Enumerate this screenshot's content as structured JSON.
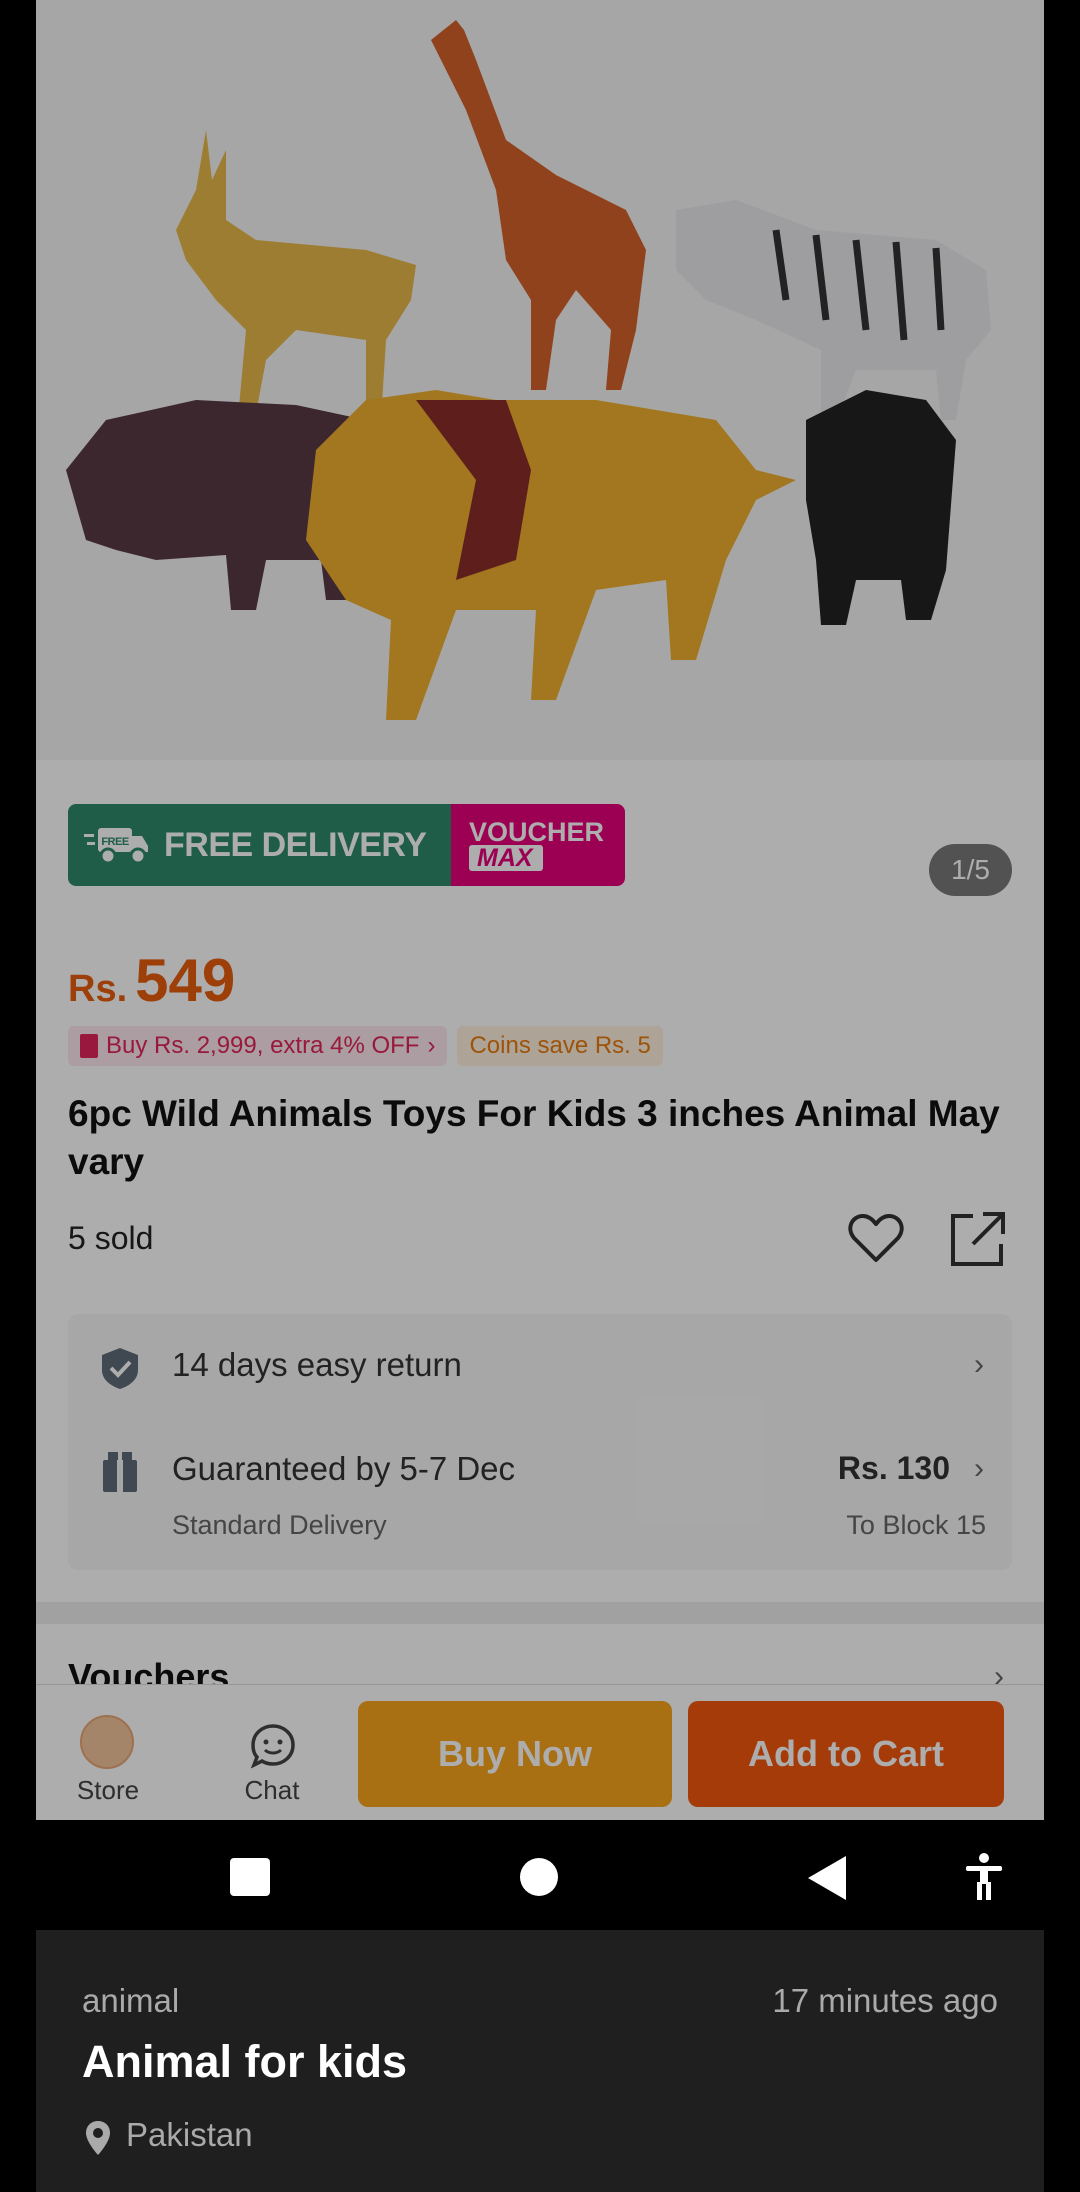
{
  "gallery": {
    "pager": "1/5"
  },
  "promo": {
    "free_delivery": "FREE DELIVERY",
    "voucher_line1": "VOUCHER",
    "voucher_line2": "MAX",
    "truck_badge": "FREE"
  },
  "price": {
    "currency": "Rs.",
    "amount": "549"
  },
  "chips": {
    "bundle": "Buy Rs. 2,999, extra 4% OFF",
    "coins": "Coins save Rs. 5"
  },
  "product": {
    "title": "6pc Wild Animals Toys For Kids 3 inches Animal May vary",
    "sold": "5 sold"
  },
  "service": {
    "return_text": "14 days easy return",
    "delivery_text": "Guaranteed by 5-7 Dec",
    "delivery_sub": "Standard Delivery",
    "delivery_price": "Rs. 130",
    "delivery_to": "To Block 15"
  },
  "vouchers": {
    "label": "Vouchers"
  },
  "bottombar": {
    "store_label": "Store",
    "chat_label": "Chat",
    "buy_now": "Buy Now",
    "add_to_cart": "Add to Cart"
  },
  "listing": {
    "category": "animal",
    "time": "17 minutes ago",
    "title": "Animal for kids",
    "location": "Pakistan"
  },
  "colors": {
    "price": "#e85d0c",
    "buy_now": "#f8a51b",
    "add_to_cart": "#f5580f",
    "free_delivery": "#2e8a6c",
    "voucher": "#e5007a"
  }
}
